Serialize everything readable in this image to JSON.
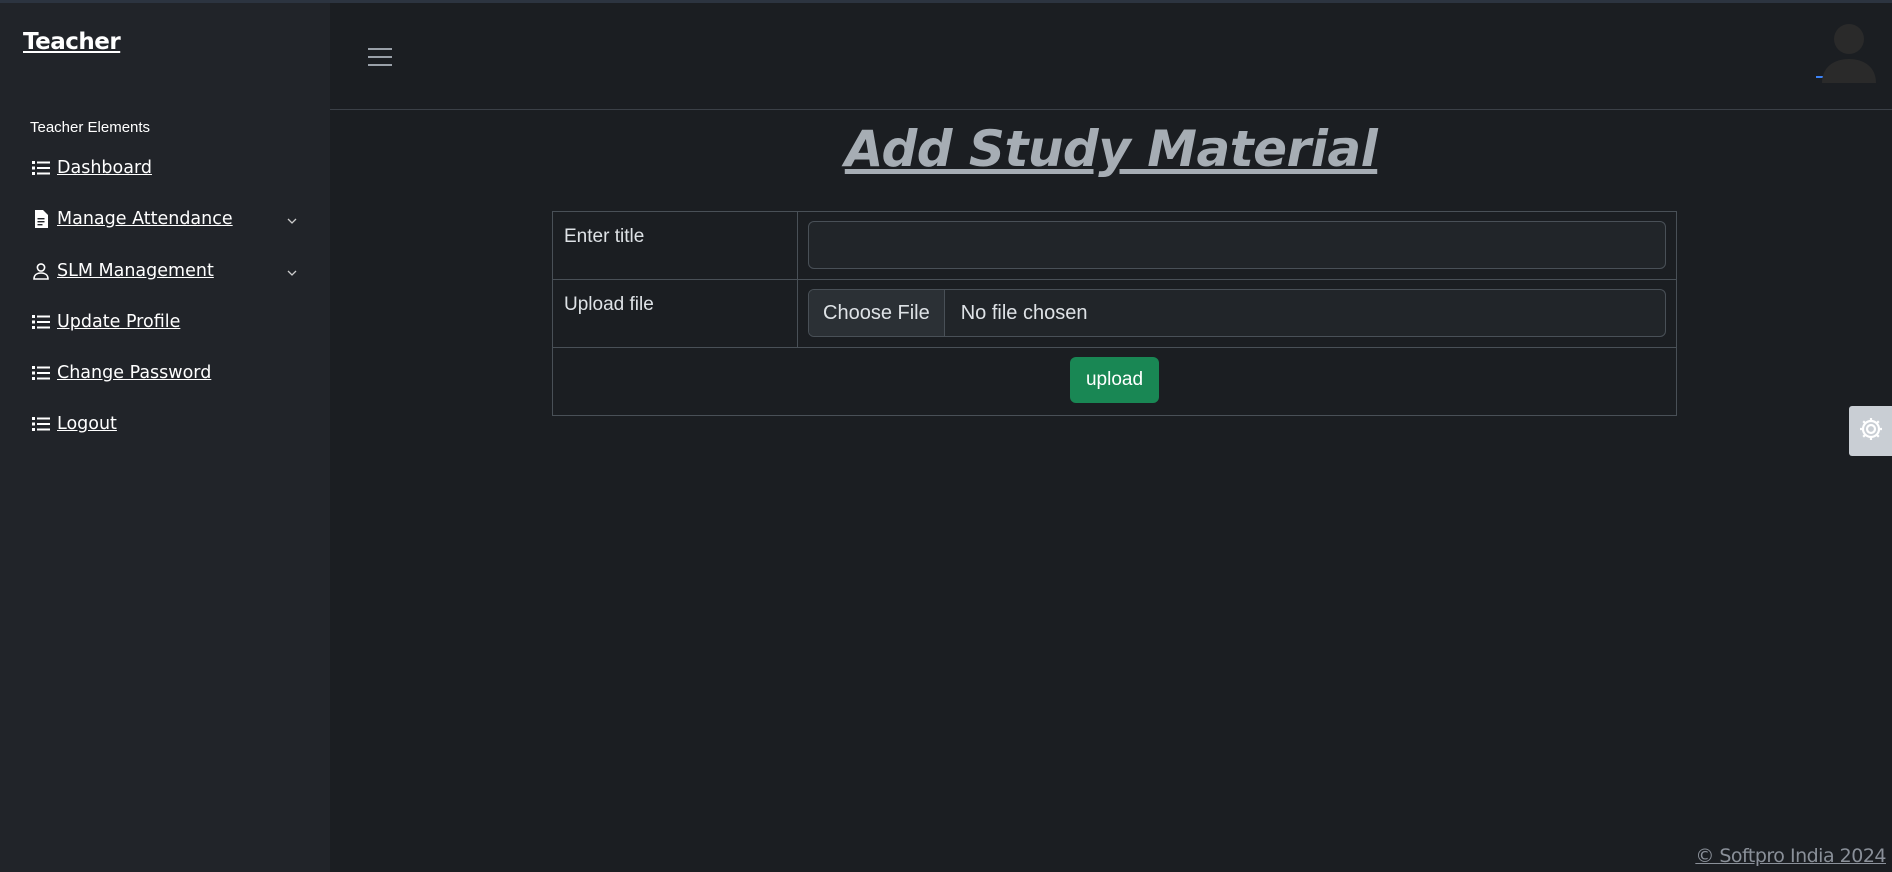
{
  "sidebar": {
    "brand": "Teacher",
    "section_label": "Teacher Elements",
    "items": [
      {
        "label": "Dashboard",
        "icon": "list-icon"
      },
      {
        "label": "Manage Attendance",
        "icon": "document-icon",
        "has_dropdown": true
      },
      {
        "label": "SLM Management",
        "icon": "user-icon",
        "has_dropdown": true
      },
      {
        "label": "Update Profile",
        "icon": "list-icon"
      },
      {
        "label": "Change Password",
        "icon": "list-icon"
      },
      {
        "label": "Logout",
        "icon": "list-icon"
      }
    ]
  },
  "header": {
    "menu_icon": "hamburger-icon",
    "avatar_icon": "user-avatar-icon"
  },
  "main": {
    "title": "Add Study Material",
    "form": {
      "title_label": "Enter title",
      "title_value": "",
      "file_label": "Upload file",
      "file_button": "Choose File",
      "file_status": "No file chosen",
      "submit_label": "upload"
    }
  },
  "settings_icon": "gear-icon",
  "footer": "© Softpro India 2024",
  "colors": {
    "background": "#1b1e22",
    "sidebar": "#212429",
    "accent_green": "#198754",
    "title": "#a6adb4"
  }
}
